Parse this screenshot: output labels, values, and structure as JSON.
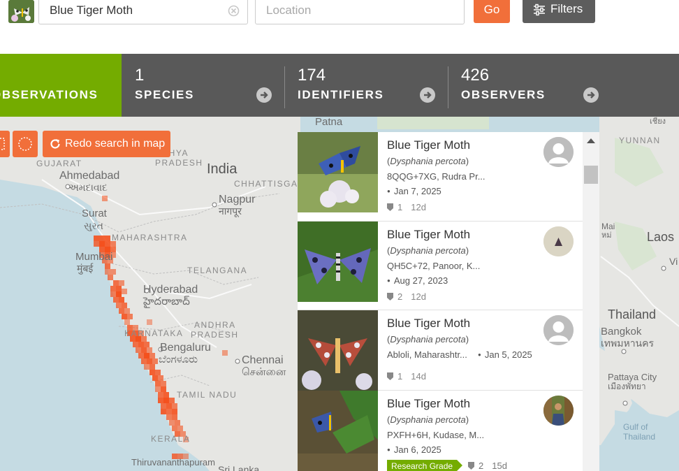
{
  "search": {
    "taxon_value": "Blue Tiger Moth",
    "location_placeholder": "Location",
    "go_label": "Go",
    "filters_label": "Filters"
  },
  "stats": {
    "observations_label": "OBSERVATIONS",
    "species_count": "1",
    "species_label": "SPECIES",
    "identifiers_count": "174",
    "identifiers_label": "IDENTIFIERS",
    "observers_count": "426",
    "observers_label": "OBSERVERS"
  },
  "map": {
    "redo_label": "Redo search in map",
    "labels": {
      "patna": "Patna",
      "yunnan": "YUNNAN",
      "gujarat": "GUJARAT",
      "madhya_pradesh": "ADHYA\nPRADESH",
      "india": "India",
      "chhattisgarh": "CHHATTISGA",
      "ahmedabad": "Ahmedabad",
      "ahmedabad_local": "અમદાવાદ",
      "nagpur": "Nagpur",
      "nagpur_local": "नागपूर",
      "surat": "Surat",
      "surat_local": "સુરત",
      "maharashtra": "MAHARASHTRA",
      "mumbai": "Mumbai",
      "mumbai_local": "मुंबई",
      "telangana": "TELANGANA",
      "hyderabad": "Hyderabad",
      "hyderabad_local": "హైదరాబాద్",
      "karnataka": "KARNATAKA",
      "andhra": "ANDHRA",
      "pradesh": "PRADESH",
      "bengaluru": "Bengaluru",
      "bengaluru_local": "ಬೆಂಗಳೂರು",
      "chennai": "Chennai",
      "chennai_local": "சென்னை",
      "tamil_nadu": "TAMIL NADU",
      "kerala": "KERALA",
      "thiruvananthapuram": "Thiruvananthapuram",
      "sri_lanka": "Sri Lanka",
      "laos": "Laos",
      "thailand": "Thailand",
      "bangkok": "Bangkok",
      "bangkok_local": "เทพมหานคร",
      "pattaya": "Pattaya City",
      "pattaya_local": "เมืองพัทยา",
      "gulf_of_thailand": "Gulf of\nThailand",
      "mai": "Mai",
      "mai_local": "หม่",
      "vi": "Vi",
      "chiang": "เชียง"
    }
  },
  "results": [
    {
      "common_name": "Blue Tiger Moth",
      "scientific_name": "Dysphania percota",
      "location": "8QQG+7XG, Rudra Pr...",
      "date": "Jan 7, 2025",
      "ids": "1",
      "age": "12d",
      "avatar": "default-user-icon",
      "research_grade": false
    },
    {
      "common_name": "Blue Tiger Moth",
      "scientific_name": "Dysphania percota",
      "location": "QH5C+72, Panoor, K...",
      "date": "Aug 27, 2023",
      "ids": "2",
      "age": "12d",
      "avatar": "moth-avatar",
      "research_grade": false
    },
    {
      "common_name": "Blue Tiger Moth",
      "scientific_name": "Dysphania percota",
      "location": "Abloli, Maharashtr...",
      "date": "Jan 5, 2025",
      "ids": "1",
      "age": "14d",
      "avatar": "default-user-icon",
      "research_grade": false
    },
    {
      "common_name": "Blue Tiger Moth",
      "scientific_name": "Dysphania percota",
      "location": "PXFH+6H, Kudase, M...",
      "date": "Jan 6, 2025",
      "ids": "2",
      "age": "15d",
      "avatar": "person-avatar",
      "research_grade": true,
      "grade_label": "Research Grade"
    }
  ],
  "colors": {
    "accent": "#74ac00",
    "orange": "#f16f3a",
    "stats_bg": "#595959"
  }
}
